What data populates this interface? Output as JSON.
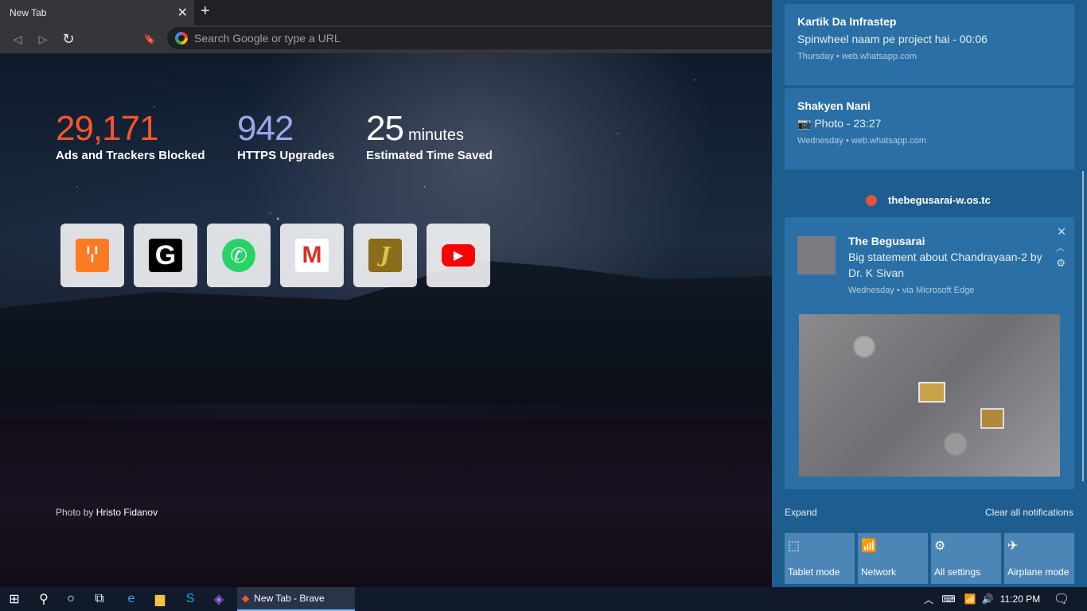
{
  "browser": {
    "tab_title": "New Tab",
    "tab_close": "✕",
    "new_tab": "+",
    "omnibox_placeholder": "Search Google or type a URL",
    "nav": {
      "back": "◁",
      "forward": "▷",
      "reload": "↻",
      "bookmark": "🔖"
    }
  },
  "stats": [
    {
      "value": "29,171",
      "unit": "",
      "label": "Ads and Trackers Blocked",
      "color": "#fb542b"
    },
    {
      "value": "942",
      "unit": "",
      "label": "HTTPS Upgrades",
      "color": "#a0a5eb"
    },
    {
      "value": "25",
      "unit": "minutes",
      "label": "Estimated Time Saved",
      "color": "#ffffff"
    }
  ],
  "top_sites": [
    {
      "icon": "xampp-icon",
      "glyph": "ꗷ",
      "bg": "#fb7a24",
      "fg": "#ffffff"
    },
    {
      "icon": "g-icon",
      "glyph": "G",
      "bg": "#000000",
      "fg": "#ffffff"
    },
    {
      "icon": "whatsapp-icon",
      "glyph": "✆",
      "bg": "#25d366",
      "fg": "#ffffff"
    },
    {
      "icon": "gmail-icon",
      "glyph": "M",
      "bg": "#ffffff",
      "fg": "#d93025"
    },
    {
      "icon": "script-icon",
      "glyph": "J",
      "bg": "#8a6d1c",
      "fg": "#e2c04a"
    },
    {
      "icon": "youtube-icon",
      "glyph": "▶",
      "bg": "#ff0000",
      "fg": "#ffffff"
    }
  ],
  "credit": {
    "prefix": "Photo by",
    "author": "Hristo Fidanov"
  },
  "action_center": {
    "cards": [
      {
        "title": "Kartik Da Infrastep",
        "body": "Spinwheel naam pe project hai - 00:06",
        "meta": "Thursday • web.whatsapp.com"
      },
      {
        "title": "Shakyen Nani",
        "body": "📷 Photo - 23:27",
        "meta": "Wednesday • web.whatsapp.com"
      }
    ],
    "group_title": "thebegusarai-w.os.tc",
    "news": {
      "title": "The Begusarai",
      "body": "Big statement about Chandrayaan-2 by Dr. K Sivan",
      "meta": "Wednesday • via Microsoft Edge"
    },
    "expand": "Expand",
    "clear_all": "Clear all notifications",
    "quick_actions": [
      {
        "label": "Tablet mode",
        "icon": "tablet-icon",
        "glyph": "⬚"
      },
      {
        "label": "Network",
        "icon": "network-icon",
        "glyph": "📶"
      },
      {
        "label": "All settings",
        "icon": "settings-icon",
        "glyph": "⚙"
      },
      {
        "label": "Airplane mode",
        "icon": "airplane-icon",
        "glyph": "✈"
      }
    ]
  },
  "taskbar": {
    "active_app": "New Tab - Brave",
    "time": "11:20 PM"
  }
}
